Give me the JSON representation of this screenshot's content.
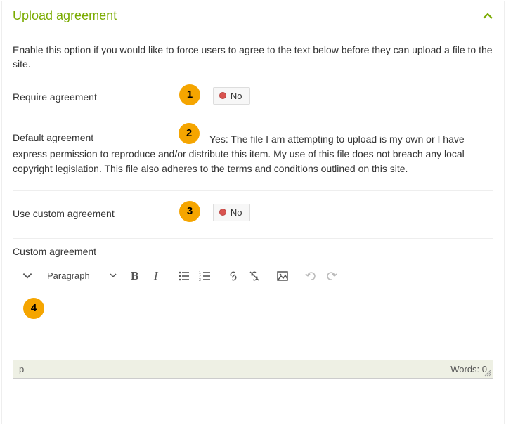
{
  "panel": {
    "title": "Upload agreement",
    "description": "Enable this option if you would like to force users to agree to the text below before they can upload a file to the site."
  },
  "fields": {
    "require_agreement": {
      "label": "Require agreement",
      "value": "No"
    },
    "default_agreement": {
      "label": "Default agreement",
      "text": "Yes: The file I am attempting to upload is my own or I have express permission to reproduce and/or distribute this item. My use of this file does not breach any local copyright legislation. This file also adheres to the terms and conditions outlined on this site."
    },
    "use_custom_agreement": {
      "label": "Use custom agreement",
      "value": "No"
    },
    "custom_agreement": {
      "label": "Custom agreement"
    }
  },
  "editor": {
    "format": "Paragraph",
    "path": "p",
    "words_label": "Words: 0"
  },
  "markers": [
    "1",
    "2",
    "3",
    "4"
  ]
}
